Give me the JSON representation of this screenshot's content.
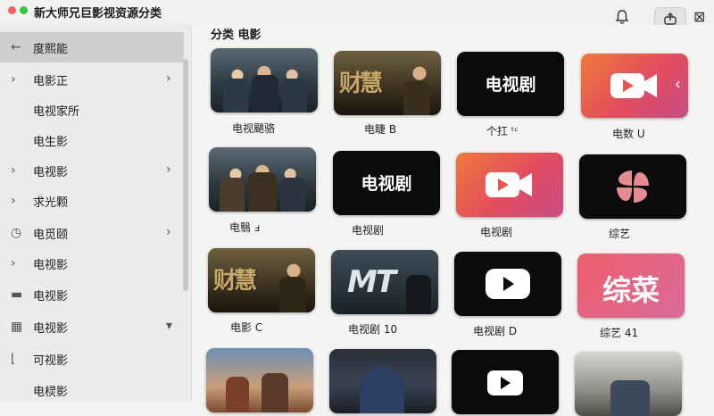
{
  "app": {
    "title": "新大师兄巨影视资源分类"
  },
  "toolbar": {
    "bell_icon": "bell-icon",
    "share_icon": "share-icon",
    "close_glyph": "⊠"
  },
  "sidebar": {
    "items": [
      {
        "label": "度熙能",
        "icon": "back-arrow-icon",
        "glyph": "←",
        "chevron": ""
      },
      {
        "label": "电影正",
        "icon": "chevron-right-icon",
        "glyph": "›",
        "chevron": "›"
      },
      {
        "label": "电视家所",
        "icon": "",
        "glyph": "",
        "chevron": ""
      },
      {
        "label": "电生影",
        "icon": "",
        "glyph": "",
        "chevron": ""
      },
      {
        "label": "电视影",
        "icon": "chevron-right-icon",
        "glyph": "›",
        "chevron": "›"
      },
      {
        "label": "求光颗",
        "icon": "chevron-right-icon",
        "glyph": "›",
        "chevron": ""
      },
      {
        "label": "电觅颐",
        "icon": "clock-icon",
        "glyph": "◷",
        "chevron": "›"
      },
      {
        "label": "电视影",
        "icon": "chevron-right-icon",
        "glyph": "›",
        "chevron": ""
      },
      {
        "label": "电视影",
        "icon": "folder-icon",
        "glyph": "▬",
        "chevron": ""
      },
      {
        "label": "电视影",
        "icon": "grid-icon",
        "glyph": "▦",
        "chevron": "▾"
      },
      {
        "label": "可视影",
        "icon": "link-icon",
        "glyph": "⌊",
        "chevron": ""
      },
      {
        "label": "电棂影",
        "icon": "",
        "glyph": "",
        "chevron": ""
      }
    ]
  },
  "main": {
    "heading": "分类  电影",
    "cards": [
      {
        "label": "电视颶骆",
        "title": ""
      },
      {
        "label": "电睫 B",
        "title": ""
      },
      {
        "label": "个扛 ᵗᶜ",
        "title": "电视剧"
      },
      {
        "label": "电数 U",
        "title": ""
      },
      {
        "label": "电翳 ⅎ",
        "title": ""
      },
      {
        "label": "电视剧",
        "title": "电视剧"
      },
      {
        "label": "电视剧",
        "title": ""
      },
      {
        "label": "综艺",
        "title": ""
      },
      {
        "label": "电影 C",
        "title": ""
      },
      {
        "label": "电视剧 10",
        "title": "MT"
      },
      {
        "label": "电视剧 D",
        "title": ""
      },
      {
        "label": "综艺 41",
        "title": "综菜"
      },
      {
        "label": "",
        "title": ""
      },
      {
        "label": "",
        "title": ""
      },
      {
        "label": "",
        "title": ""
      },
      {
        "label": "",
        "title": ""
      }
    ],
    "gold_text": "财慧"
  },
  "colors": {
    "accent_red": "#fd5f57",
    "accent_green": "#2fc842",
    "play_orange": "#f07a3a",
    "play_pink": "#d96a9a"
  }
}
